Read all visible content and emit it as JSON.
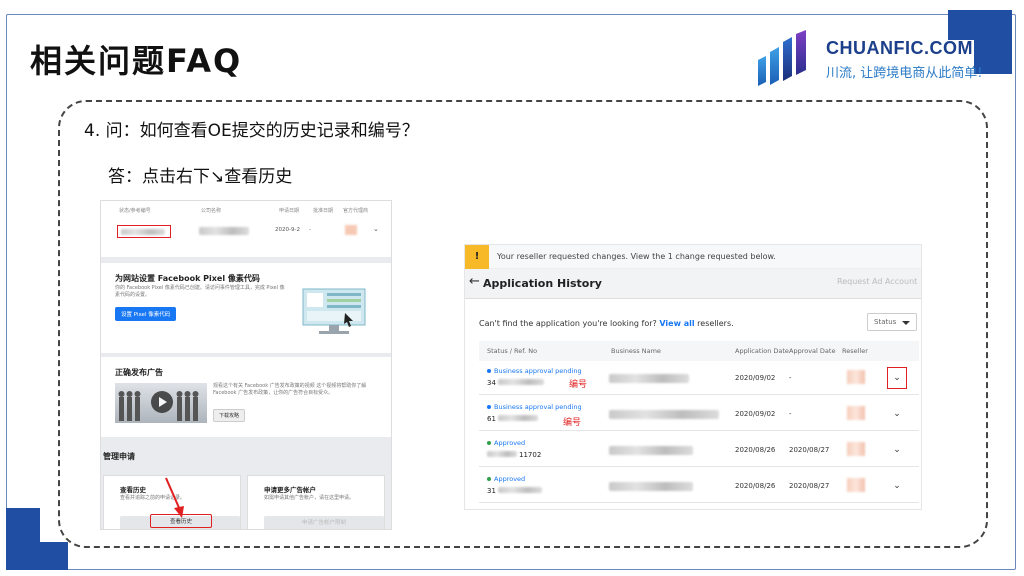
{
  "slide": {
    "title": "相关问题FAQ",
    "question": "4. 问：如何查看OE提交的历史记录和编号？",
    "answer": "答：点击右下↘查看历史"
  },
  "logo": {
    "name": "CHUANFIC.COM",
    "slogan": "川流, 让跨境电商从此简单!"
  },
  "left_screenshot": {
    "columns": [
      "状态/参考编号",
      "公司名称",
      "申请日期",
      "批准日期",
      "官方代理商"
    ],
    "row_date": "2020-9-2",
    "row_dash": "-",
    "pixel_title": "为网站设置 Facebook Pixel 像素代码",
    "pixel_desc": "你的 Facebook Pixel 像素代码已创建。请访问事件管理工具，完成 Pixel 像素代码的设置。",
    "pixel_button": "设置 Pixel 像素代码",
    "ad_title": "正确发布广告",
    "ad_desc": "观看这个有关 Facebook 广告发布政策的视频 这个视频将帮助你了解 Facebook 广告发布政策，让你的广告符合目标受众。",
    "ad_button": "下载攻略",
    "manage_title": "管理申请",
    "card1_title": "查看历史",
    "card1_desc": "查看并追踪之前的申请记录。",
    "card1_button": "查看历史",
    "card2_title": "申请更多广告帐户",
    "card2_desc": "如需申请其他广告帐户，请在这里申请。",
    "card2_button": "申请广告帐户限制"
  },
  "right_screenshot": {
    "banner_icon": "!",
    "banner": "Your reseller requested changes. View the 1 change requested below.",
    "title": "Application History",
    "request_button": "Request Ad Account",
    "cant_find": "Can't find the application you're looking for?",
    "view_all": "View all",
    "resellers": "resellers.",
    "status_filter": "Status",
    "headers": {
      "status": "Status / Ref. No",
      "business": "Business Name",
      "app_date": "Application Date",
      "approval_date": "Approval Date",
      "reseller": "Reseller"
    },
    "rows": [
      {
        "status": "Business approval pending",
        "ref": "34",
        "app_date": "2020/09/02",
        "approval_date": "-",
        "label": "编号"
      },
      {
        "status": "Business approval pending",
        "ref": "61",
        "app_date": "2020/09/02",
        "approval_date": "-",
        "label": "编号"
      },
      {
        "status": "Approved",
        "ref": "11702",
        "app_date": "2020/08/26",
        "approval_date": "2020/08/27",
        "label": ""
      },
      {
        "status": "Approved",
        "ref": "31",
        "app_date": "2020/08/26",
        "approval_date": "2020/08/27",
        "label": ""
      }
    ]
  },
  "colors": {
    "accent_blue": "#1f4ea3",
    "facebook_blue": "#1877f2",
    "highlight_red": "#e02020",
    "warning_yellow": "#f7b928"
  },
  "icons": {
    "back": "arrow-left-icon",
    "warning": "warning-icon",
    "expand": "chevron-down-icon",
    "play": "play-icon"
  }
}
